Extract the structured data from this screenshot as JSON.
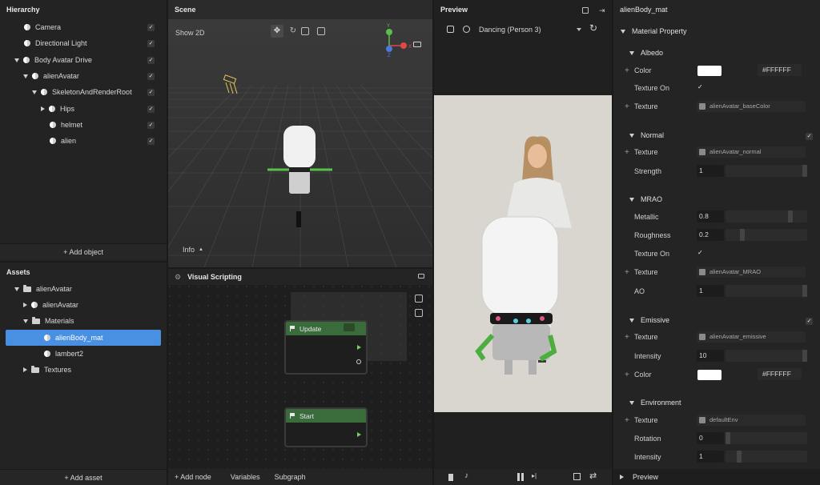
{
  "hierarchy": {
    "title": "Hierarchy",
    "items": [
      {
        "label": "Camera",
        "checked": true
      },
      {
        "label": "Directional Light",
        "checked": true
      },
      {
        "label": "Body Avatar Drive",
        "checked": true
      },
      {
        "label": "alienAvatar",
        "checked": true
      },
      {
        "label": "SkeletonAndRenderRoot",
        "checked": true
      },
      {
        "label": "Hips",
        "checked": true
      },
      {
        "label": "helmet",
        "checked": true
      },
      {
        "label": "alien",
        "checked": true
      }
    ],
    "add_label": "+ Add object"
  },
  "assets": {
    "title": "Assets",
    "items": [
      {
        "label": "alienAvatar"
      },
      {
        "label": "alienAvatar"
      },
      {
        "label": "Materials"
      },
      {
        "label": "alienBody_mat",
        "selected": true
      },
      {
        "label": "lambert2"
      },
      {
        "label": "Textures"
      }
    ],
    "add_label": "+ Add asset"
  },
  "scene": {
    "title": "Scene",
    "show2d": "Show 2D",
    "info": "Info",
    "gizmo": {
      "y": "Y",
      "x": "X",
      "z": "Z"
    }
  },
  "visual_scripting": {
    "title": "Visual Scripting",
    "nodes": [
      {
        "label": "Update"
      },
      {
        "label": "Start"
      }
    ],
    "footer": {
      "add_node": "+ Add node",
      "variables": "Variables",
      "subgraph": "Subgraph"
    }
  },
  "preview": {
    "title": "Preview",
    "animation": "Dancing (Person 3)"
  },
  "inspector": {
    "title": "alienBody_mat",
    "material_property": "Material Property",
    "albedo": {
      "title": "Albedo",
      "color_label": "Color",
      "color_hex": "#FFFFFF",
      "texture_on_label": "Texture On",
      "texture_label": "Texture",
      "texture_value": "alienAvatar_baseColor"
    },
    "normal": {
      "title": "Normal",
      "texture_label": "Texture",
      "texture_value": "alienAvatar_normal",
      "strength_label": "Strength",
      "strength_value": "1"
    },
    "mrao": {
      "title": "MRAO",
      "metallic_label": "Metallic",
      "metallic_value": "0.8",
      "roughness_label": "Roughness",
      "roughness_value": "0.2",
      "texture_on_label": "Texture On",
      "texture_label": "Texture",
      "texture_value": "alienAvatar_MRAO",
      "ao_label": "AO",
      "ao_value": "1"
    },
    "emissive": {
      "title": "Emissive",
      "texture_label": "Texture",
      "texture_value": "alienAvatar_emissive",
      "intensity_label": "Intensity",
      "intensity_value": "10",
      "color_label": "Color",
      "color_hex": "#FFFFFF"
    },
    "environment": {
      "title": "Environment",
      "texture_label": "Texture",
      "texture_value": "defaultEnv",
      "rotation_label": "Rotation",
      "rotation_value": "0",
      "intensity_label": "Intensity",
      "intensity_value": "1"
    },
    "preview_footer": "Preview"
  },
  "colors": {
    "accent": "#4a90e2",
    "node_header": "#3a6b3a",
    "background": "#232323"
  }
}
